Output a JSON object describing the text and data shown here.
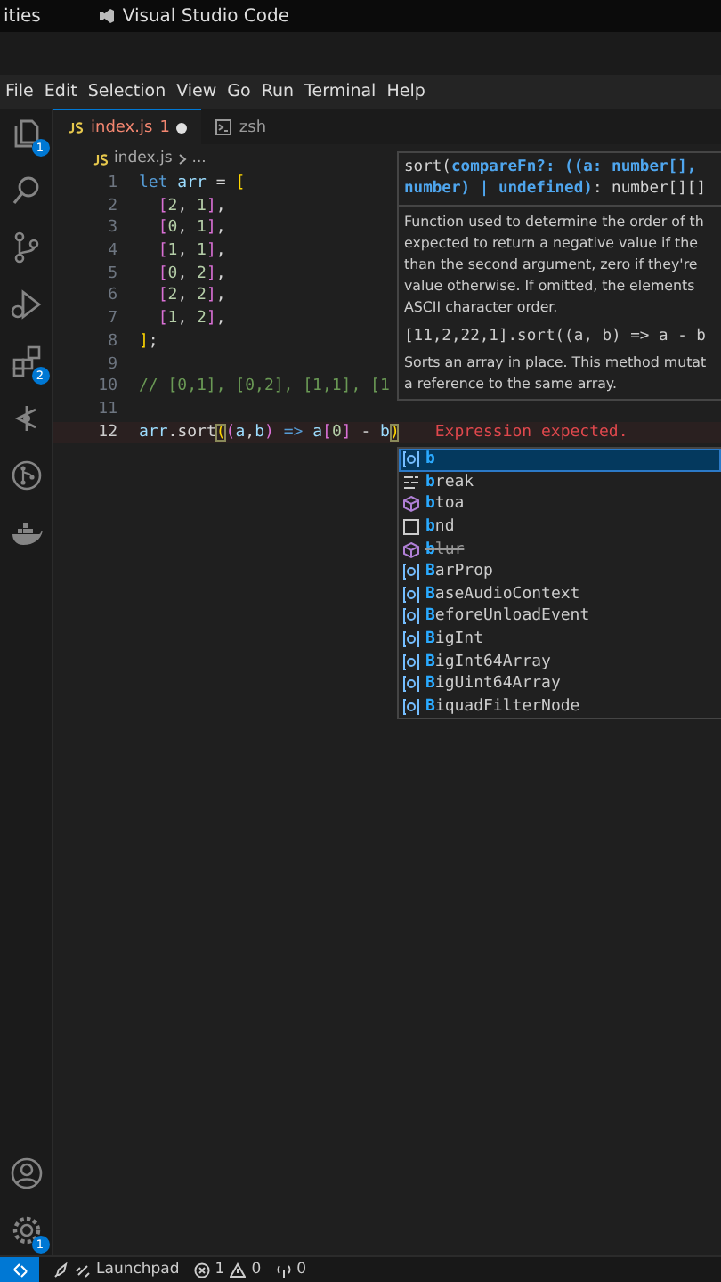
{
  "top_bar": {
    "activities": "ities",
    "app_title": "Visual Studio Code"
  },
  "menu": [
    {
      "label": "File"
    },
    {
      "label": "Edit"
    },
    {
      "label": "Selection"
    },
    {
      "label": "View"
    },
    {
      "label": "Go"
    },
    {
      "label": "Run"
    },
    {
      "label": "Terminal"
    },
    {
      "label": "Help"
    }
  ],
  "activity_bar": {
    "top": [
      {
        "kind": "explorer",
        "badge": "1"
      },
      {
        "kind": "search"
      },
      {
        "kind": "source-control"
      },
      {
        "kind": "run-debug"
      },
      {
        "kind": "extensions",
        "badge": "2"
      },
      {
        "kind": "gitlens"
      },
      {
        "kind": "pull-requests"
      },
      {
        "kind": "docker"
      }
    ],
    "bottom": [
      {
        "kind": "account"
      },
      {
        "kind": "settings",
        "badge": "1"
      }
    ]
  },
  "tabs": [
    {
      "label": "index.js",
      "kind": "js",
      "selected": true,
      "problems": "1",
      "modified": true
    },
    {
      "label": "zsh",
      "kind": "terminal",
      "selected": false,
      "modified": false
    }
  ],
  "breadcrumb": [
    "index.js",
    "..."
  ],
  "editor": {
    "lines": [
      {
        "number": "1",
        "current": false,
        "tokens": [
          {
            "text": "let",
            "kind": "keyword"
          },
          {
            "text": " arr",
            "kind": "variable"
          },
          {
            "text": " = ",
            "kind": "plain"
          },
          {
            "text": "[",
            "kind": "bracket1"
          }
        ]
      },
      {
        "number": "2",
        "current": false,
        "tokens": [
          {
            "text": "  [",
            "kind": "bracket2"
          },
          {
            "text": "2",
            "kind": "number"
          },
          {
            "text": ", ",
            "kind": "plain"
          },
          {
            "text": "1",
            "kind": "number"
          },
          {
            "text": "]",
            "kind": "bracket2"
          },
          {
            "text": ",",
            "kind": "plain"
          }
        ]
      },
      {
        "number": "3",
        "current": false,
        "tokens": [
          {
            "text": "  [",
            "kind": "bracket2"
          },
          {
            "text": "0",
            "kind": "number"
          },
          {
            "text": ", ",
            "kind": "plain"
          },
          {
            "text": "1",
            "kind": "number"
          },
          {
            "text": "]",
            "kind": "bracket2"
          },
          {
            "text": ",",
            "kind": "plain"
          }
        ]
      },
      {
        "number": "4",
        "current": false,
        "tokens": [
          {
            "text": "  [",
            "kind": "bracket2"
          },
          {
            "text": "1",
            "kind": "number"
          },
          {
            "text": ", ",
            "kind": "plain"
          },
          {
            "text": "1",
            "kind": "number"
          },
          {
            "text": "]",
            "kind": "bracket2"
          },
          {
            "text": ",",
            "kind": "plain"
          }
        ]
      },
      {
        "number": "5",
        "current": false,
        "tokens": [
          {
            "text": "  [",
            "kind": "bracket2"
          },
          {
            "text": "0",
            "kind": "number"
          },
          {
            "text": ", ",
            "kind": "plain"
          },
          {
            "text": "2",
            "kind": "number"
          },
          {
            "text": "]",
            "kind": "bracket2"
          },
          {
            "text": ",",
            "kind": "plain"
          }
        ]
      },
      {
        "number": "6",
        "current": false,
        "tokens": [
          {
            "text": "  [",
            "kind": "bracket2"
          },
          {
            "text": "2",
            "kind": "number"
          },
          {
            "text": ", ",
            "kind": "plain"
          },
          {
            "text": "2",
            "kind": "number"
          },
          {
            "text": "]",
            "kind": "bracket2"
          },
          {
            "text": ",",
            "kind": "plain"
          }
        ]
      },
      {
        "number": "7",
        "current": false,
        "tokens": [
          {
            "text": "  [",
            "kind": "bracket2"
          },
          {
            "text": "1",
            "kind": "number"
          },
          {
            "text": ", ",
            "kind": "plain"
          },
          {
            "text": "2",
            "kind": "number"
          },
          {
            "text": "]",
            "kind": "bracket2"
          },
          {
            "text": ",",
            "kind": "plain"
          }
        ]
      },
      {
        "number": "8",
        "current": false,
        "tokens": [
          {
            "text": "]",
            "kind": "bracket1"
          },
          {
            "text": ";",
            "kind": "plain"
          }
        ]
      },
      {
        "number": "9",
        "current": false
      },
      {
        "number": "10",
        "current": false,
        "tokens": [
          {
            "text": "// [0,1], [0,2], [1,1], [1",
            "kind": "comment"
          }
        ]
      },
      {
        "number": "11",
        "current": false
      },
      {
        "number": "12",
        "current": true,
        "error": "Expression expected.",
        "tokens": [
          {
            "text": "arr",
            "kind": "variable"
          },
          {
            "text": ".",
            "kind": "plain"
          },
          {
            "text": "sort",
            "kind": "plain"
          },
          {
            "text": "(",
            "kind": "bracket-match"
          },
          {
            "text": "(",
            "kind": "bracket2"
          },
          {
            "text": "a",
            "kind": "variable"
          },
          {
            "text": ",",
            "kind": "plain"
          },
          {
            "text": "b",
            "kind": "variable"
          },
          {
            "text": ")",
            "kind": "bracket2"
          },
          {
            "text": " =>",
            "kind": "keyword"
          },
          {
            "text": " a",
            "kind": "variable"
          },
          {
            "text": "[",
            "kind": "bracket2"
          },
          {
            "text": "0",
            "kind": "number"
          },
          {
            "text": "]",
            "kind": "bracket2"
          },
          {
            "text": " - ",
            "kind": "plain"
          },
          {
            "text": "b",
            "kind": "variable"
          },
          {
            "text": ")",
            "kind": "bracket-match"
          }
        ]
      }
    ]
  },
  "hover": {
    "signature_lines": [
      [
        {
          "text": "sort(",
          "kind": "plain"
        },
        {
          "text": "compareFn?: ((a: number[],",
          "kind": "param"
        }
      ],
      [
        {
          "text": "number) | undefined)",
          "kind": "param"
        },
        {
          "text": ": number[][]",
          "kind": "plain"
        }
      ]
    ],
    "doc_lines": [
      "Function used to determine the order of th",
      "expected to return a negative value if the",
      "than the second argument, zero if they're",
      "value otherwise. If omitted, the elements",
      "ASCII character order."
    ],
    "example": "[11,2,22,1].sort((a, b) => a - b",
    "summary_lines": [
      "Sorts an array in place. This method mutat",
      "a reference to the same array."
    ]
  },
  "suggestions": [
    {
      "kind": "variable",
      "label": "**b**",
      "selected": true,
      "deprecated": false
    },
    {
      "kind": "keyword",
      "label": "**b**reak",
      "selected": false,
      "deprecated": false
    },
    {
      "kind": "method",
      "label": "**b**toa",
      "selected": false,
      "deprecated": false
    },
    {
      "kind": "unit",
      "label": "**b**nd",
      "selected": false,
      "deprecated": false
    },
    {
      "kind": "method",
      "label": "**b**lur",
      "selected": false,
      "deprecated": true
    },
    {
      "kind": "variable",
      "label": "**B**arProp",
      "selected": false,
      "deprecated": false
    },
    {
      "kind": "variable",
      "label": "**B**aseAudioContext",
      "selected": false,
      "deprecated": false
    },
    {
      "kind": "variable",
      "label": "**B**eforeUnloadEvent",
      "selected": false,
      "deprecated": false
    },
    {
      "kind": "variable",
      "label": "**B**igInt",
      "selected": false,
      "deprecated": false
    },
    {
      "kind": "variable",
      "label": "**B**igInt64Array",
      "selected": false,
      "deprecated": false
    },
    {
      "kind": "variable",
      "label": "**B**igUint64Array",
      "selected": false,
      "deprecated": false
    },
    {
      "kind": "variable",
      "label": "**B**iquadFilterNode",
      "selected": false,
      "deprecated": false
    }
  ],
  "status_bar": {
    "launchpad": "Launchpad",
    "errors": "1",
    "warnings": "0",
    "ports": "0"
  }
}
